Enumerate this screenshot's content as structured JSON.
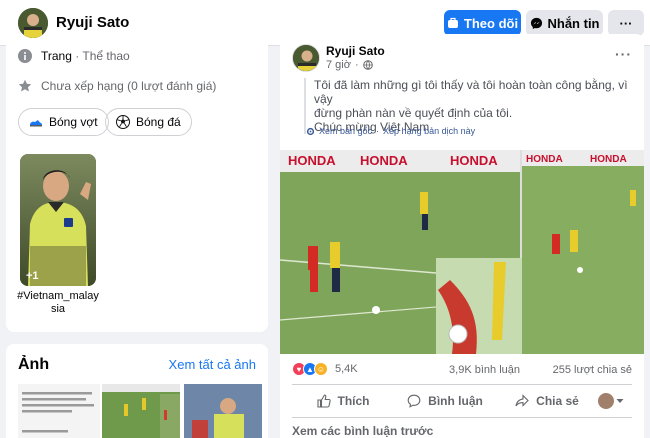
{
  "header": {
    "page_name": "Ryuji Sato",
    "follow_label": "Theo dõi",
    "message_label": "Nhắn tin",
    "more_label": "···"
  },
  "about": {
    "category_label": "Trang",
    "category_sep": " · ",
    "category_value": "Thể thao",
    "rating_text": "Chưa xếp hạng (0 lượt đánh giá)"
  },
  "chips": [
    {
      "label": "Bóng vợt",
      "icon": "sneaker-icon"
    },
    {
      "label": "Bóng đá",
      "icon": "soccer-ball-icon"
    }
  ],
  "featured": {
    "overlay_count": "+1",
    "caption": "#Vietnam_malay sia"
  },
  "photos": {
    "title": "Ảnh",
    "see_all": "Xem tất cả ảnh"
  },
  "post": {
    "author": "Ryuji Sato",
    "time": "7 giờ",
    "privacy_icon": "globe-icon",
    "more_label": "···",
    "text_line1": "Tôi đã làm những gì tôi thấy và tôi hoàn toàn công bằng, vì vậy",
    "text_line2": "đừng phàn nàn về quyết định của tôi.",
    "text_line3": "Chúc mừng Việt Nam",
    "translate_original": "Xem bản gốc",
    "translate_rate": "Xếp hạng bản dịch này",
    "translate_sep": " · ",
    "reactions_count": "5,4K",
    "comments_count": "3,9K bình luận",
    "shares_count": "255 lượt chia sẻ",
    "like_label": "Thích",
    "comment_label": "Bình luận",
    "share_label": "Chia sẻ",
    "previous_comments": "Xem các bình luận trước"
  },
  "colors": {
    "accent": "#1877f2",
    "like": "#1877f2",
    "love": "#f33e58",
    "haha": "#f7b125"
  }
}
